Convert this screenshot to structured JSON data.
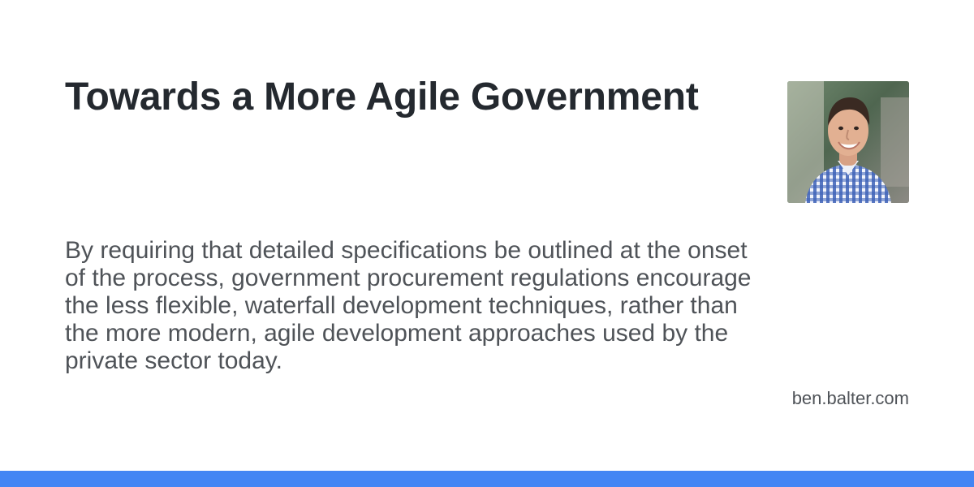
{
  "post": {
    "title": "Towards a More Agile Government",
    "description": "By requiring that detailed specifications be outlined at the onset of the process, government procurement regulations encourage the less flexible, waterfall development techniques, rather than the more modern, agile development approaches used by the private sector today.",
    "domain": "ben.balter.com"
  },
  "author": {
    "photo": "author-portrait"
  },
  "theme": {
    "accent_color": "#4285f4",
    "title_color": "#24292f",
    "text_color": "#4f5358",
    "background_color": "#ffffff"
  }
}
